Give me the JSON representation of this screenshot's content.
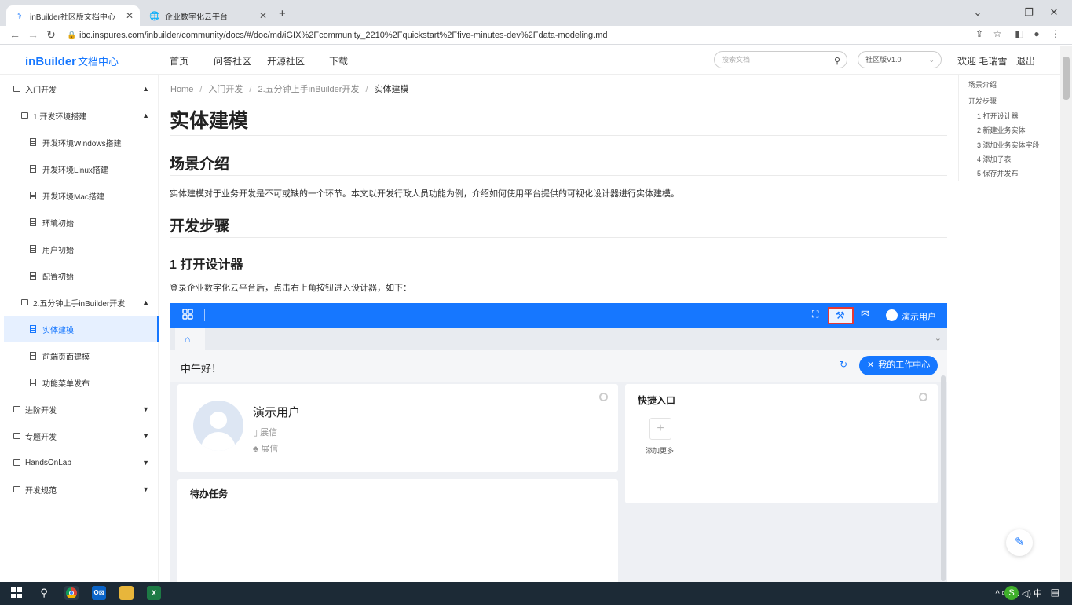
{
  "browser": {
    "tabs": [
      {
        "label": "inBuilder社区版文档中心",
        "active": true,
        "icon": "inbuilder-logo-icon"
      },
      {
        "label": "企业数字化云平台",
        "active": false,
        "icon": "globe-icon"
      }
    ],
    "new_tab": "+",
    "url": "ibc.inspures.com/inbuilder/community/docs/#/doc/md/iGIX%2Fcommunity_2210%2Fquickstart%2Ffive-minutes-dev%2Fdata-modeling.md"
  },
  "header": {
    "logo": "inBuilder",
    "logo_suffix": "文档中心",
    "nav": [
      "首页",
      "问答社区",
      "开源社区",
      "下载"
    ],
    "search_placeholder": "搜索文档",
    "version": "社区版V1.0",
    "welcome": "欢迎 毛瑞雪",
    "logout": "退出"
  },
  "sidebar": {
    "items": [
      {
        "label": "入门开发",
        "level": 0,
        "type": "folder",
        "arrow": "▲"
      },
      {
        "label": "1.开发环境搭建",
        "level": 1,
        "type": "folder",
        "arrow": "▲"
      },
      {
        "label": "开发环境Windows搭建",
        "level": 2,
        "type": "doc"
      },
      {
        "label": "开发环境Linux搭建",
        "level": 2,
        "type": "doc"
      },
      {
        "label": "开发环境Mac搭建",
        "level": 2,
        "type": "doc"
      },
      {
        "label": "环境初始",
        "level": 2,
        "type": "doc"
      },
      {
        "label": "用户初始",
        "level": 2,
        "type": "doc"
      },
      {
        "label": "配置初始",
        "level": 2,
        "type": "doc"
      },
      {
        "label": "2.五分钟上手inBuilder开发",
        "level": 1,
        "type": "folder",
        "arrow": "▲"
      },
      {
        "label": "实体建模",
        "level": 2,
        "type": "doc",
        "active": true
      },
      {
        "label": "前端页面建模",
        "level": 2,
        "type": "doc"
      },
      {
        "label": "功能菜单发布",
        "level": 2,
        "type": "doc"
      },
      {
        "label": "进阶开发",
        "level": 0,
        "type": "folder",
        "arrow": "▼"
      },
      {
        "label": "专题开发",
        "level": 0,
        "type": "folder",
        "arrow": "▼"
      },
      {
        "label": "HandsOnLab",
        "level": 0,
        "type": "folder",
        "arrow": "▼"
      },
      {
        "label": "开发规范",
        "level": 0,
        "type": "folder",
        "arrow": "▼"
      }
    ]
  },
  "breadcrumb": [
    "Home",
    "入门开发",
    "2.五分钟上手inBuilder开发",
    "实体建模"
  ],
  "article": {
    "title": "实体建模",
    "h_scene": "场景介绍",
    "scene_text": "实体建模对于业务开发是不可或缺的一个环节。本文以开发行政人员功能为例，介绍如何使用平台提供的可视化设计器进行实体建模。",
    "h_steps": "开发步骤",
    "h_step1": "1 打开设计器",
    "step1_text": "登录企业数字化云平台后，点击右上角按钮进入设计器，如下："
  },
  "toc": [
    "场景介绍",
    "开发步骤",
    "1 打开设计器",
    "2 新建业务实体",
    "3 添加业务实体字段",
    "4 添加子表",
    "5 保存并发布"
  ],
  "embedded": {
    "user_menu": "演示用户",
    "greeting": "中午好！",
    "work_center": "我的工作中心",
    "profile_name": "演示用户",
    "profile_org1": "展信",
    "profile_org2": "展信",
    "quick_title": "快捷入口",
    "add_more": "添加更多",
    "todo_title": "待办任务"
  },
  "taskbar": {
    "tray": "^ ✉ ⟁ ◁) 中"
  },
  "colors": {
    "accent": "#1677ff",
    "highlight": "#e53935"
  }
}
